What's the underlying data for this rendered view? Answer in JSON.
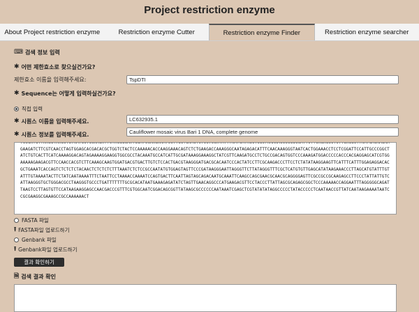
{
  "page": {
    "title": "Project restriction enzyme"
  },
  "tabs": [
    {
      "label": "About Project restriction enzyme",
      "active": false
    },
    {
      "label": "Restriction enzyme Cutter",
      "active": false
    },
    {
      "label": "Restriction enzyme Finder",
      "active": true
    },
    {
      "label": "Restriction enzyme searcher",
      "active": false
    }
  ],
  "form": {
    "section_title": "검색 정보 입력",
    "question1": "어떤 제한효소로 찾으실건가요?",
    "enzyme_label": "제한효소 이름을 입력해주세요:",
    "enzyme_value": "TspDTI",
    "question2": "Sequence는 어떻게 입력하실건가요?",
    "direct_input": "직접 입력",
    "seq_name_label": "시퀀스 이름을 입력해주세요.",
    "seq_name_value": "LC632935.1",
    "seq_info_label": "시퀀스 정보를 입력해주세요.",
    "seq_info_value": "Cauliflower mosaic virus Bari 1 DNA, complete genome",
    "sequence": "TCCGATGTTAAGGTAAGCTGTAATGCTGCAAGATTCTAGGGCAATGGATCCAAGAAATCCTTGCTGAAGTCTCCTCCATATTTAATCATAGCTCGCTAAAAACCCCGGCCATTCTTCAGAGCCTCTTGAGGCTTAATGACAAGAAGAAGATCTTCGTCAACCTAGTGGAGCACGACACGCTGGTCTACTCCAAAAACACCAAGGAAACAGTCTCTGAAGACCAAAGGGCAATAGAGACATTTCAACAAAGGGTAATCACTGGAAACCTCCTCGGATTCCATTGCCCGGCTATCTGTCACTTCATCAAAAGGACAGTAGAAAAGGAAGGTGGCGCCTACAAATGCCATCATTGCGATAAAGGAAAGGCTATCGTTCAAGATGCCTCTGCCGACAGTGGTCCCAAAGATGGACCCCCACCCACGAGGAGCATCGTGGAAAAAGAAGACGTTCCAACCACGTCTTCAAAGCAAGTGGATGACGTGACTTGTCTCCACTGACGTAAGGGATGACGCACAATCCCACTATCCTTCGCAAGACCCTTCCTCTATATAAGGAAGTTCATTTCATTTGGAGAGGACACGCTGAAATCACCAGTCTCTCTCTACAACTCTCTCTCTTTAAATCTCTCCGCCAATATGTGGAGTAGTTCCCGATAAGGGAATTAGGGTTCTTATAGGGTTTCGCTCATGTGTTGAGCATATAAGAAACCCTTAGCATGTATTTGTATTTGTAAAATACTTCTATCAATAAAATTTCTAATTCCTAAAACCAAAATCCAGTGACTTCAATTAGTAGCAGACAATGCAAATTCAAGCCAGCGAACGCAACGCAGGGGAGTTCGCCGCCGCAAGAGCCTTCCCTATTATTGTCATTAAGGGTGCTGGGACGCCTAAGGGTGCCCTGATTTTTTTGCGCACATAATGAAAGAGATATCTAGTTGAACAGGCCCATGAAGACGTTCCTACCCTTATTAGCGCAGAGCGGCTCCCAAAAACCAGGAATTTAGGGGGCAGATTAAGTCCTTAGTGTTCCATAAGAAGGAGCCAACGACCCGTTTCGTGGCAATCGGACAGCGGTTATAAGCGCCCCCCAATAAATCGAGCTCGTATATATAGGCCCCCTATACCCCCTCAATAACCGTTATCAATAAGAAAATAATCCGCGAAGGCGAAAGCCGCCAAAAAACT",
    "options": [
      {
        "label": "FASTA 파일",
        "selected": false
      },
      {
        "label": "FASTA파일 업로드하기",
        "icon": "upload-icon"
      },
      {
        "label": "Genbank 파일",
        "selected": false
      },
      {
        "label": "Genbank파일 업로드하기",
        "icon": "upload-icon"
      }
    ],
    "submit_label": "결과 확인하기"
  },
  "result": {
    "section_title": "검색 결과 확인"
  }
}
